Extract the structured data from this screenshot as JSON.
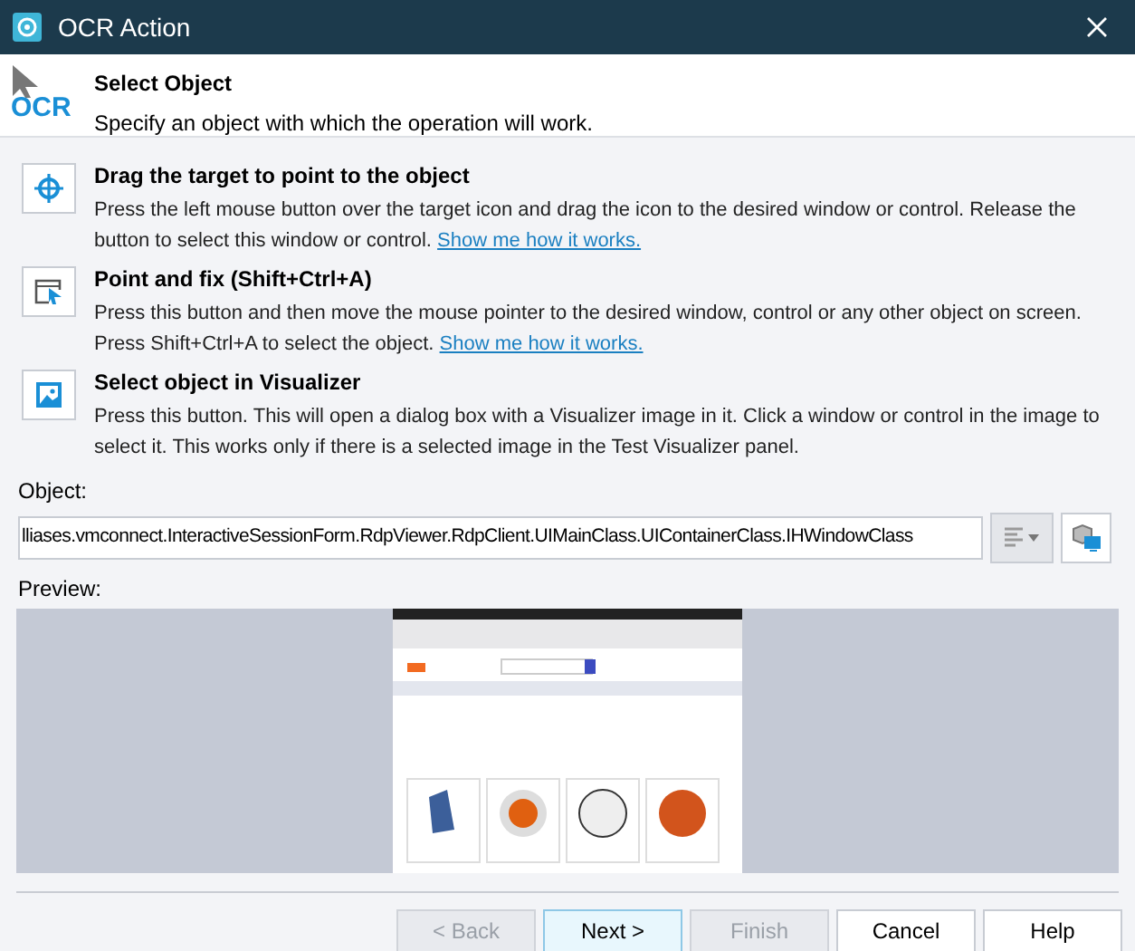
{
  "window": {
    "title": "OCR Action"
  },
  "header": {
    "logo_text": "OCR",
    "title": "Select Object",
    "subtitle": "Specify an object with which the operation will work."
  },
  "options": [
    {
      "kind": "target",
      "title": "Drag the target to point to the object",
      "text": "Press the left mouse button over the target icon and drag the icon to the desired window or control. Release the button to select this window or control.",
      "link": "Show me how it works."
    },
    {
      "kind": "point",
      "title": "Point and fix (Shift+Ctrl+A)",
      "text": "Press this button and then move the mouse pointer to the desired window, control or any other object on screen. Press Shift+Ctrl+A to select the object.",
      "link": "Show me how it works."
    },
    {
      "kind": "visualizer",
      "title": "Select object in Visualizer",
      "text": "Press this button. This will open a dialog box with a Visualizer image in it. Click a window or control in the image to select it. This works only if there is a selected image in the Test Visualizer panel."
    }
  ],
  "object": {
    "label": "Object:",
    "value": "lliases.vmconnect.InteractiveSessionForm.RdpViewer.RdpClient.UIMainClass.UIContainerClass.IHWindowClass"
  },
  "preview": {
    "label": "Preview:"
  },
  "buttons": [
    {
      "label": "< Back",
      "disabled": true,
      "default": false
    },
    {
      "label": "Next >",
      "disabled": false,
      "default": true
    },
    {
      "label": "Finish",
      "disabled": true,
      "default": false
    },
    {
      "label": "Cancel",
      "disabled": false,
      "default": false
    },
    {
      "label": "Help",
      "disabled": false,
      "default": false
    }
  ]
}
